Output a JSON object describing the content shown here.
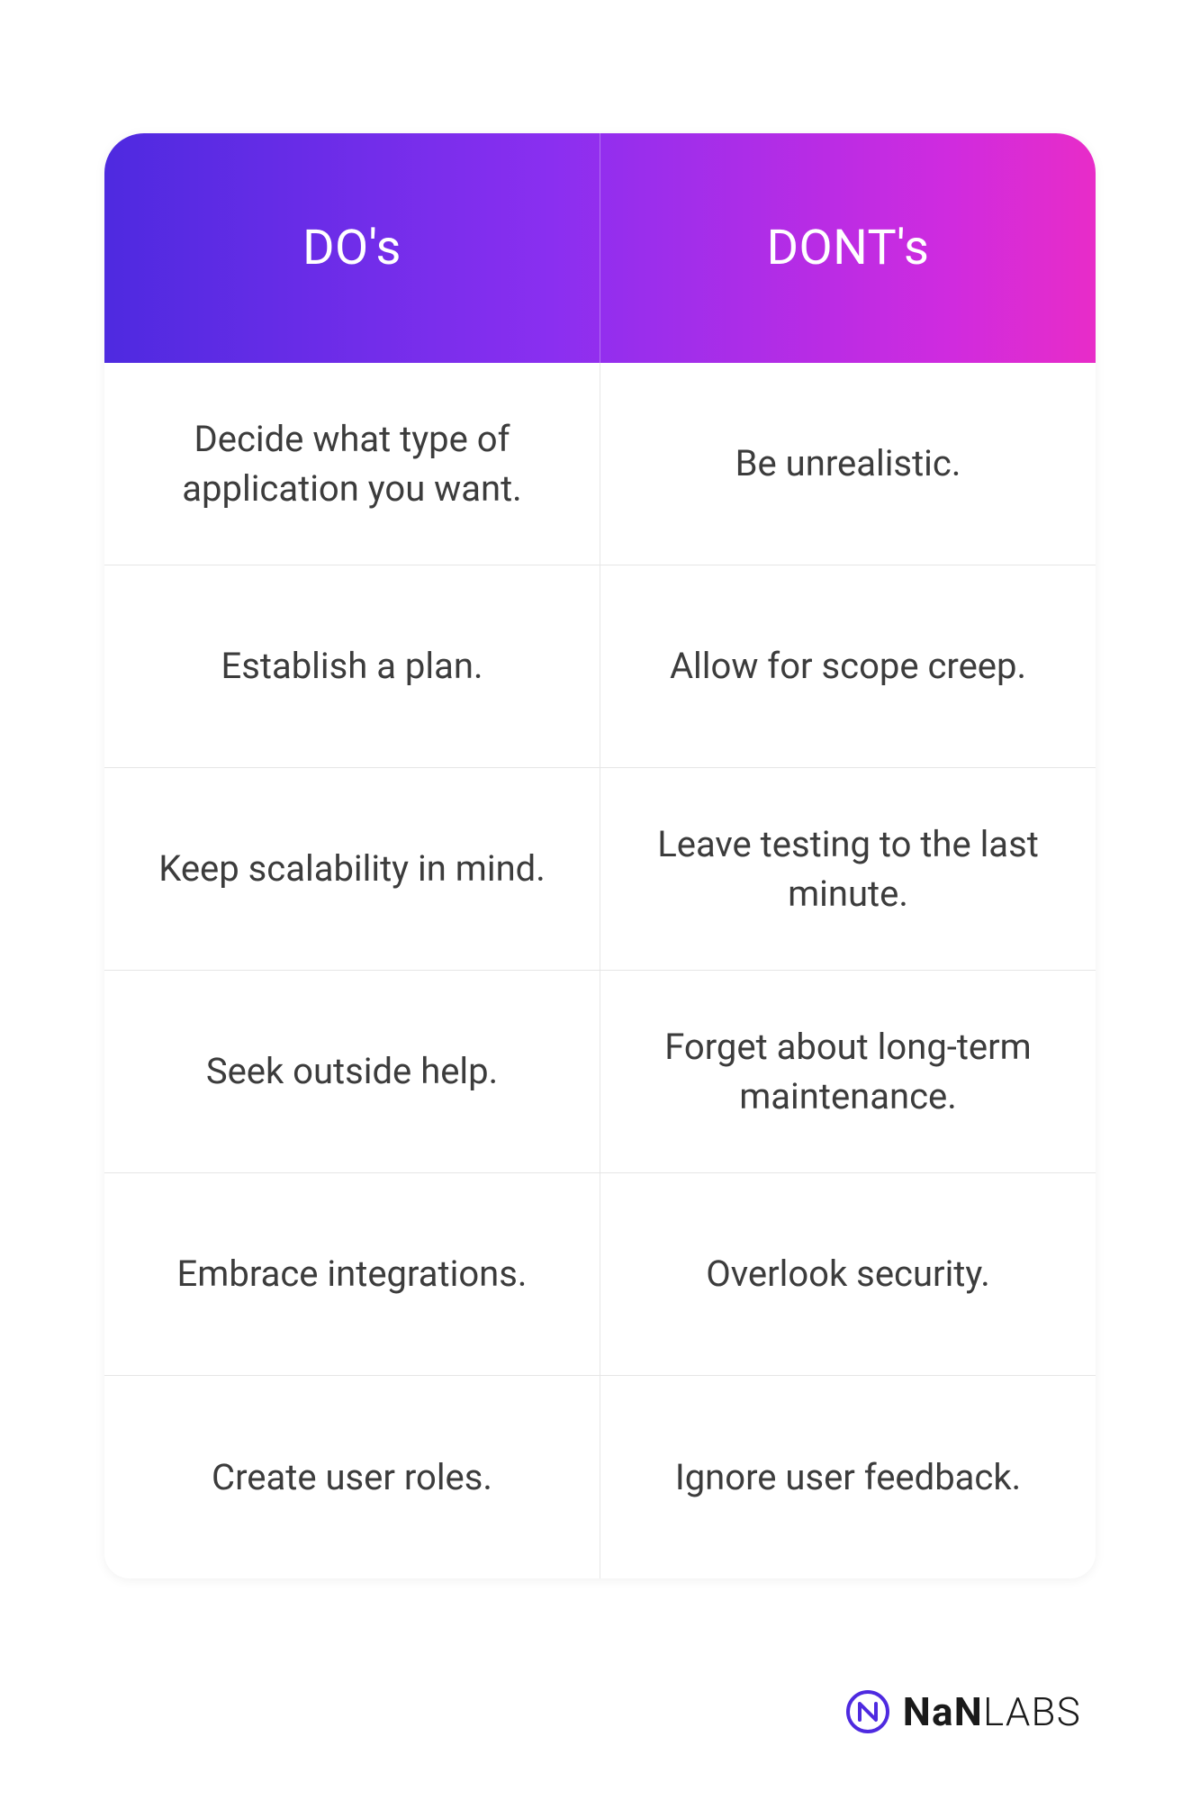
{
  "header": {
    "dos": "DO's",
    "donts": "DONT's"
  },
  "rows": [
    {
      "do": "Decide what type of application you want.",
      "dont": "Be unrealistic."
    },
    {
      "do": "Establish a plan.",
      "dont": "Allow for scope creep."
    },
    {
      "do": "Keep scalability in mind.",
      "dont": "Leave testing to the last minute."
    },
    {
      "do": "Seek outside help.",
      "dont": "Forget about long-term maintenance."
    },
    {
      "do": "Embrace integrations.",
      "dont": "Overlook security."
    },
    {
      "do": "Create user roles.",
      "dont": "Ignore user feedback."
    }
  ],
  "brand": {
    "name_bold": "NaN",
    "name_light": "LABS",
    "icon": "nan-circle-icon",
    "accent_color": "#4e2ae0"
  }
}
